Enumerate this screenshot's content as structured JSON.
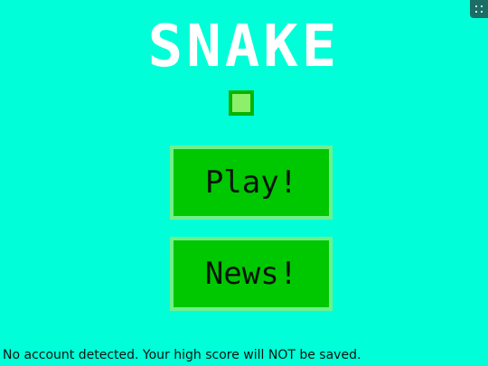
{
  "game": {
    "title": "SNAKE",
    "logo_icon": "snake-food-square-icon",
    "menu": {
      "play_label": "Play!",
      "news_label": "News!"
    },
    "status_message": "No account detected. Your high score will NOT be saved."
  },
  "chrome": {
    "corner_icon": "expand-icon"
  },
  "colors": {
    "background": "#00ffd8",
    "title": "#ffffff",
    "button_fill": "#00c800",
    "button_border": "#70f08a",
    "square_fill": "#8ef06a",
    "square_border": "#06b400"
  }
}
